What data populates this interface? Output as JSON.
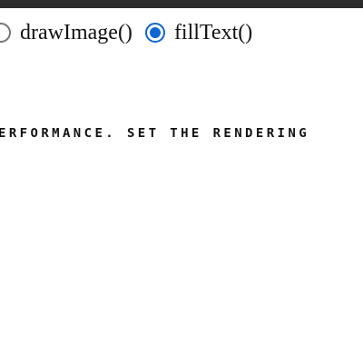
{
  "render_mode": {
    "options": [
      {
        "label": "drawImage()",
        "checked": false
      },
      {
        "label": "fillText()",
        "checked": true
      }
    ]
  },
  "canvas": {
    "text": "ERFORMANCE. SET THE RENDERING"
  },
  "colors": {
    "radio_checked": "#0f66d0",
    "radio_unchecked": "#767676",
    "top_bar": "#2b2b2b"
  }
}
